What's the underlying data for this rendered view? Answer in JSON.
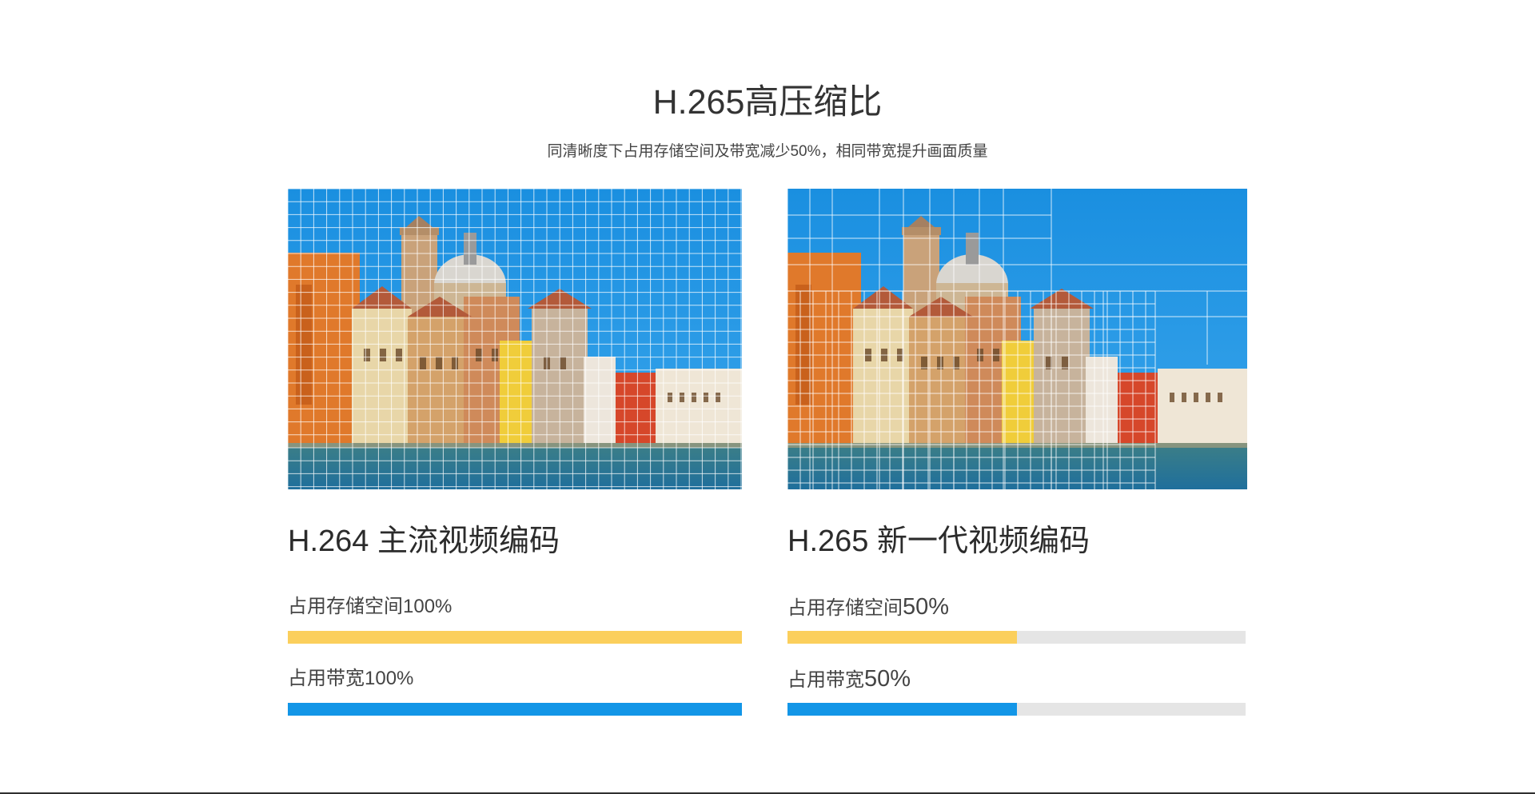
{
  "header": {
    "title": "H.265高压缩比",
    "subtitle": "同清晰度下占用存储空间及带宽减少50%，相同带宽提升画面质量"
  },
  "colors": {
    "storage_bar": "#fbcf5c",
    "bandwidth_bar": "#1396e7",
    "track": "#e5e5e5",
    "text": "#333333"
  },
  "panels": [
    {
      "id": "h264",
      "image": "venice-canal-photo-dense-grid",
      "codec_title": "H.264 主流视频编码",
      "storage": {
        "label": "占用存储空间",
        "value": "100%",
        "fraction": 1.0
      },
      "bandwidth": {
        "label": "占用带宽",
        "value": "100%",
        "fraction": 1.0
      }
    },
    {
      "id": "h265",
      "image": "venice-canal-photo-adaptive-grid",
      "codec_title": "H.265 新一代视频编码",
      "storage": {
        "label": "占用存储空间",
        "value": "50%",
        "fraction": 0.5
      },
      "bandwidth": {
        "label": "占用带宽",
        "value": "50%",
        "fraction": 0.5
      }
    }
  ]
}
